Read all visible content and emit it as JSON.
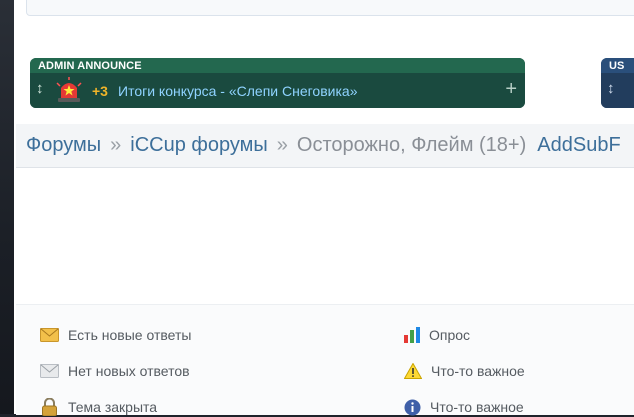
{
  "announcement": {
    "header": "ADMIN ANNOUNCE",
    "count": "+3",
    "link_text": "Итоги конкурса - «Слепи Снеговика»"
  },
  "announcement2": {
    "header": "US"
  },
  "breadcrumb": {
    "items": [
      "Форумы",
      "iCCup форумы",
      "Осторожно, Флейм (18+)",
      "AddSubF"
    ],
    "separator": "»"
  },
  "legend": {
    "items": [
      {
        "icon": "envelope-new-icon",
        "label": "Есть новые ответы"
      },
      {
        "icon": "envelope-read-icon",
        "label": "Нет новых ответов"
      },
      {
        "icon": "lock-icon",
        "label": "Тема закрыта"
      },
      {
        "icon": "poll-icon",
        "label": "Опрос"
      },
      {
        "icon": "warning-icon",
        "label": "Что-то важное"
      },
      {
        "icon": "info-icon",
        "label": "Что-то важное"
      }
    ]
  },
  "colors": {
    "announce_green": "#1e5b45",
    "link_blue": "#3d6f9a",
    "count_gold": "#f0b429"
  }
}
